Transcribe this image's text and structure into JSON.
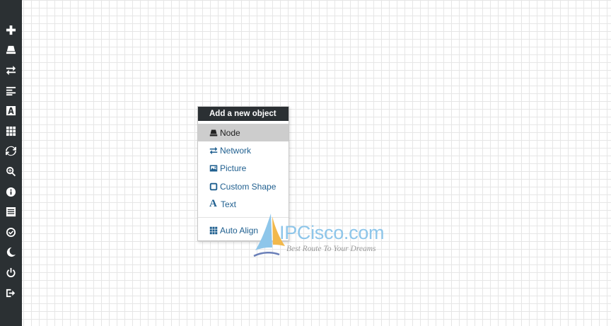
{
  "sidebar": {
    "items": [
      {
        "icon": "plus-icon"
      },
      {
        "icon": "node-icon"
      },
      {
        "icon": "network-icon"
      },
      {
        "icon": "align-left-icon"
      },
      {
        "icon": "text-icon"
      },
      {
        "icon": "grid-icon"
      },
      {
        "icon": "refresh-icon"
      },
      {
        "icon": "zoom-icon"
      },
      {
        "icon": "info-icon"
      },
      {
        "icon": "list-icon"
      },
      {
        "icon": "check-circle-icon"
      },
      {
        "icon": "moon-icon"
      },
      {
        "icon": "power-icon"
      },
      {
        "icon": "logout-icon"
      }
    ],
    "background": "#2b3033"
  },
  "context_menu": {
    "title": "Add a new object",
    "items": [
      {
        "label": "Node",
        "icon": "node-icon"
      },
      {
        "label": "Network",
        "icon": "network-icon"
      },
      {
        "label": "Picture",
        "icon": "picture-icon"
      },
      {
        "label": "Custom Shape",
        "icon": "custom-shape-icon"
      },
      {
        "label": "Text",
        "icon": "text-icon"
      },
      {
        "label": "Auto Align",
        "icon": "grid-icon"
      }
    ],
    "link_color": "#1f5f8f"
  },
  "watermark": {
    "title": "IPCisco.com",
    "tagline": "Best Route To Your Dreams"
  }
}
